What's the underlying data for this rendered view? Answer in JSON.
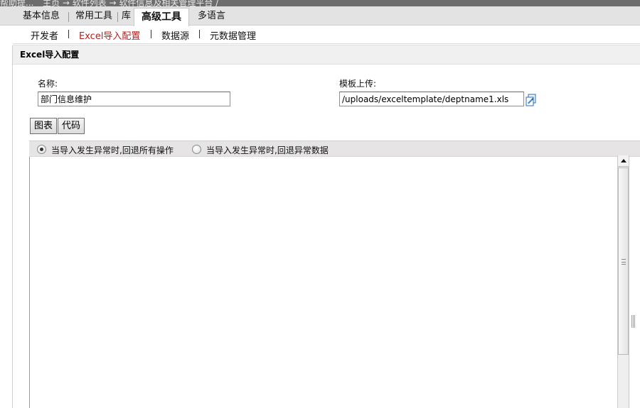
{
  "title_bar": {
    "segments": [
      "帮助提...",
      "主页 → 软件列表 → 软件信息及相关管理平台 / "
    ]
  },
  "main_tabs": [
    {
      "label": "基本信息"
    },
    {
      "label": "常用工具"
    },
    {
      "label": "库"
    },
    {
      "label": "高级工具"
    },
    {
      "label": "多语言"
    }
  ],
  "sub_tabs": [
    {
      "label": "开发者"
    },
    {
      "label": "Excel导入配置"
    },
    {
      "label": "数据源"
    },
    {
      "label": "元数据管理"
    }
  ],
  "section": {
    "title": "Excel导入配置"
  },
  "form": {
    "name_label": "名称:",
    "name_value": "部门信息维护",
    "template_label": "模板上传:",
    "template_value": "/uploads/exceltemplate/deptname1.xls"
  },
  "view_buttons": {
    "chart": "图表",
    "code": "代码"
  },
  "radio_options": [
    {
      "label": "当导入发生异常时,回退所有操作",
      "checked": true
    },
    {
      "label": "当导入发生异常时,回退异常数据",
      "checked": false
    }
  ],
  "icons": {
    "upload": "upload-file-icon",
    "scroll_up": "scroll-up-arrow-icon"
  }
}
